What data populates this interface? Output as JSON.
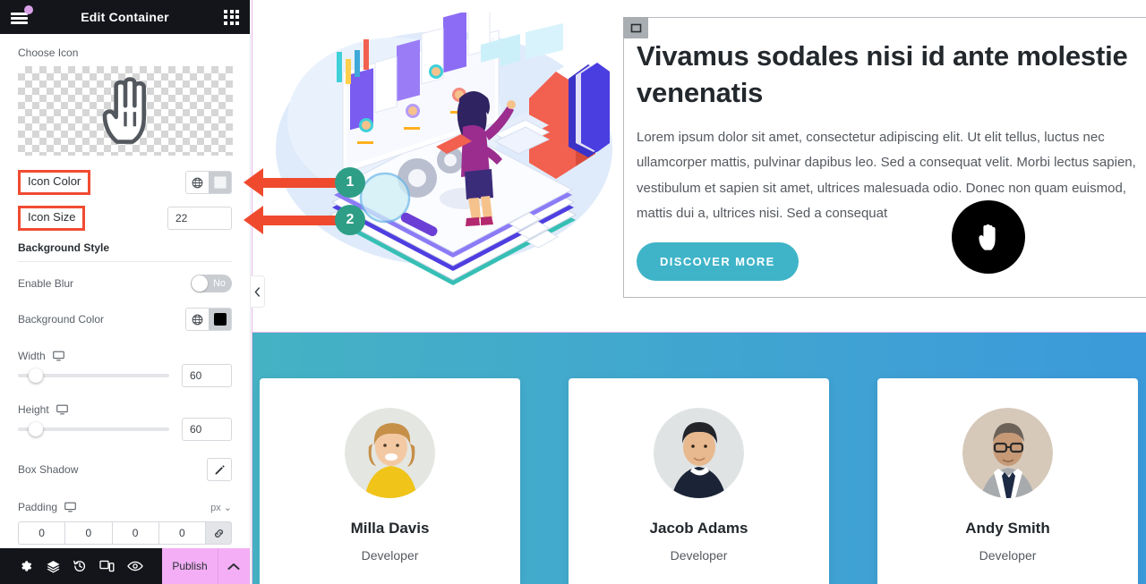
{
  "panel": {
    "title": "Edit Container",
    "menu_icon": "hamburger-icon",
    "apps_icon": "grid-apps-icon",
    "controls": {
      "choose_icon_label": "Choose Icon",
      "icon_preview_glyph": "pointing-hand-icon",
      "icon_color_label": "Icon Color",
      "icon_color_swatch": "#f4f5f6",
      "icon_size_label": "Icon Size",
      "icon_size_value": "22",
      "background_style_label": "Background Style",
      "enable_blur_label": "Enable Blur",
      "enable_blur_value": "No",
      "background_color_label": "Background Color",
      "background_color_swatch": "#000000",
      "width_label": "Width",
      "width_value": "60",
      "height_label": "Height",
      "height_value": "60",
      "box_shadow_label": "Box Shadow",
      "padding_label": "Padding",
      "padding_unit": "px",
      "padding_values": [
        "0",
        "0",
        "0",
        "0"
      ]
    },
    "footer": {
      "tools": [
        {
          "name": "settings-gear-icon",
          "label": "Settings"
        },
        {
          "name": "layers-navigator-icon",
          "label": "Navigator"
        },
        {
          "name": "history-icon",
          "label": "History"
        },
        {
          "name": "responsive-mode-icon",
          "label": "Responsive Mode"
        },
        {
          "name": "preview-eye-icon",
          "label": "Preview Changes"
        }
      ],
      "publish_label": "Publish",
      "publish_caret": "chevron-up-icon",
      "publish_color": "#f3aef5"
    },
    "collapse_icon": "chevron-left-icon"
  },
  "canvas": {
    "hero": {
      "handle_icon": "container-handle-icon",
      "title": "Vivamus sodales nisi id ante molestie venenatis",
      "paragraph": "Lorem ipsum dolor sit amet, consectetur adipiscing elit. Ut elit tellus, luctus nec ullamcorper mattis, pulvinar dapibus leo. Sed a consequat velit. Morbi lectus sapien, vestibulum et sapien sit amet, ultrices malesuada odio. Donec non quam euismod, mattis dui a, ultrices nisi. Sed a consequat",
      "cta_label": "DISCOVER MORE",
      "cta_color": "#3fb4c8",
      "illustration_name": "isometric-team-review-illustration"
    },
    "cursor_bubble": {
      "name": "mouse-cursor-preview-bubble",
      "background": "#000000",
      "glyph": "pointing-hand-icon"
    },
    "band": {
      "gradient_from": "#45b2c4",
      "gradient_to": "#3a9ada"
    },
    "team": [
      {
        "name": "Milla Davis",
        "role": "Developer",
        "avatar": "avatar-milla-davis"
      },
      {
        "name": "Jacob Adams",
        "role": "Developer",
        "avatar": "avatar-jacob-adams"
      },
      {
        "name": "Andy Smith",
        "role": "Developer",
        "avatar": "avatar-andy-smith"
      }
    ]
  },
  "annotations": [
    {
      "number": "1",
      "target": "Icon Color",
      "color": "#ef4a2e",
      "badge_color": "#2e9e86"
    },
    {
      "number": "2",
      "target": "Icon Size",
      "color": "#ef4a2e",
      "badge_color": "#2e9e86"
    }
  ]
}
